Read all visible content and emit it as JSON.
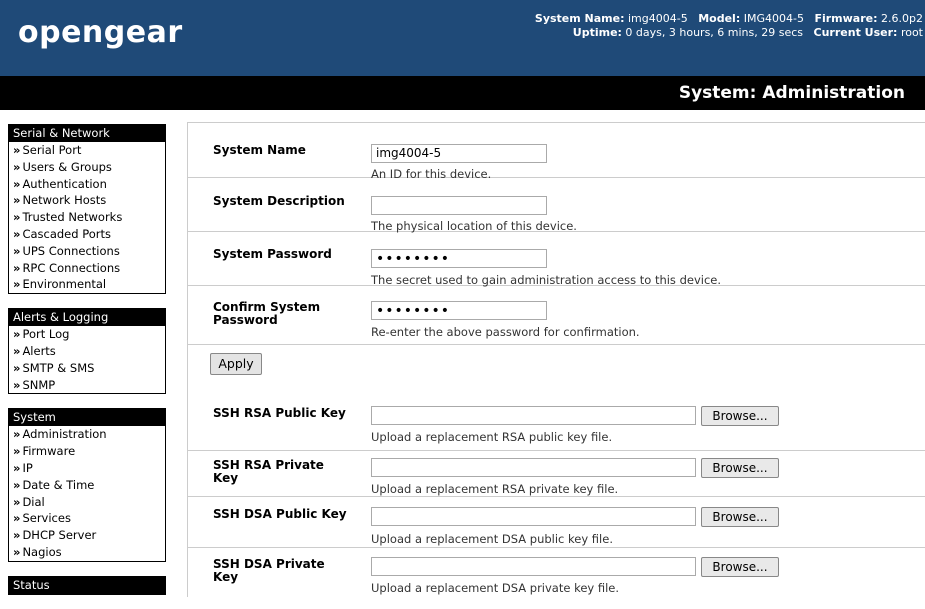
{
  "header": {
    "logo": "opengear",
    "system_name_label": "System Name:",
    "system_name_value": "img4004-5",
    "model_label": "Model:",
    "model_value": "IMG4004-5",
    "firmware_label": "Firmware:",
    "firmware_value": "2.6.0p2",
    "uptime_label": "Uptime:",
    "uptime_value": "0 days, 3 hours, 6 mins, 29 secs",
    "current_user_label": "Current User:",
    "current_user_value": "root"
  },
  "page_title": "System: Administration",
  "sidebar": {
    "groups": [
      {
        "title": "Serial & Network",
        "items": [
          "Serial Port",
          "Users & Groups",
          "Authentication",
          "Network Hosts",
          "Trusted Networks",
          "Cascaded Ports",
          "UPS Connections",
          "RPC Connections",
          "Environmental"
        ]
      },
      {
        "title": "Alerts & Logging",
        "items": [
          "Port Log",
          "Alerts",
          "SMTP & SMS",
          "SNMP"
        ]
      },
      {
        "title": "System",
        "items": [
          "Administration",
          "Firmware",
          "IP",
          "Date & Time",
          "Dial",
          "Services",
          "DHCP Server",
          "Nagios"
        ]
      },
      {
        "title": "Status",
        "items": []
      }
    ],
    "arrow": "»"
  },
  "form": {
    "system_name": {
      "label": "System Name",
      "value": "img4004-5",
      "hint": "An ID for this device."
    },
    "system_description": {
      "label": "System Description",
      "value": "",
      "hint": "The physical location of this device."
    },
    "system_password": {
      "label": "System Password",
      "value": "••••••••",
      "hint": "The secret used to gain administration access to this device."
    },
    "confirm_password": {
      "label": "Confirm System Password",
      "value": "••••••••",
      "hint": "Re-enter the above password for confirmation."
    },
    "apply_label": "Apply",
    "browse_label": "Browse...",
    "ssh_rsa_public": {
      "label": "SSH RSA Public Key",
      "hint": "Upload a replacement RSA public key file."
    },
    "ssh_rsa_private": {
      "label": "SSH RSA Private Key",
      "hint": "Upload a replacement RSA private key file."
    },
    "ssh_dsa_public": {
      "label": "SSH DSA Public Key",
      "hint": "Upload a replacement DSA public key file."
    },
    "ssh_dsa_private": {
      "label": "SSH DSA Private Key",
      "hint": "Upload a replacement DSA private key file."
    }
  }
}
